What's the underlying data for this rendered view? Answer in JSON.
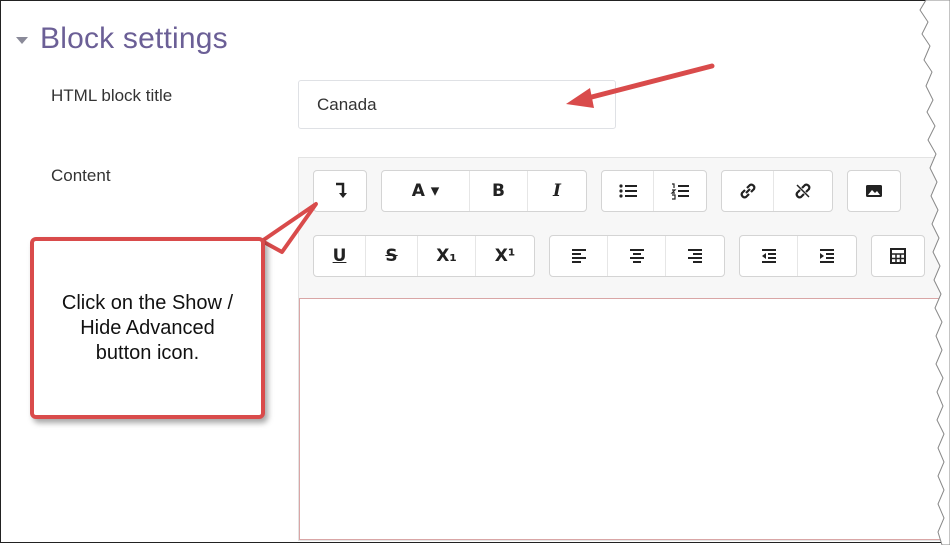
{
  "section": {
    "title": "Block settings"
  },
  "form": {
    "title_label": "HTML block title",
    "title_value": "Canada",
    "content_label": "Content"
  },
  "toolbar": {
    "row1": [
      [
        "show-hide-advanced-icon"
      ],
      [
        "font-color-button-label",
        "bold-icon",
        "italic-icon"
      ],
      [
        "unordered-list-icon",
        "ordered-list-icon"
      ],
      [
        "link-icon",
        "unlink-icon"
      ],
      [
        "image-icon"
      ]
    ],
    "row2": [
      [
        "underline-icon",
        "strikethrough-icon",
        "subscript-icon",
        "superscript-icon"
      ],
      [
        "align-left-icon",
        "align-center-icon",
        "align-right-icon"
      ],
      [
        "outdent-icon",
        "indent-icon"
      ],
      [
        "table-icon"
      ]
    ],
    "font_color_label": "A ▾",
    "bold_label": "B",
    "italic_label": "I",
    "underline_label": "U",
    "strike_label": "S",
    "subscript_label": "X₁",
    "superscript_label": "X¹"
  },
  "callout": {
    "text": "Click on the Show / Hide Advanced button icon."
  },
  "colors": {
    "accent": "#6b5f96",
    "arrow": "#d94b4b"
  }
}
